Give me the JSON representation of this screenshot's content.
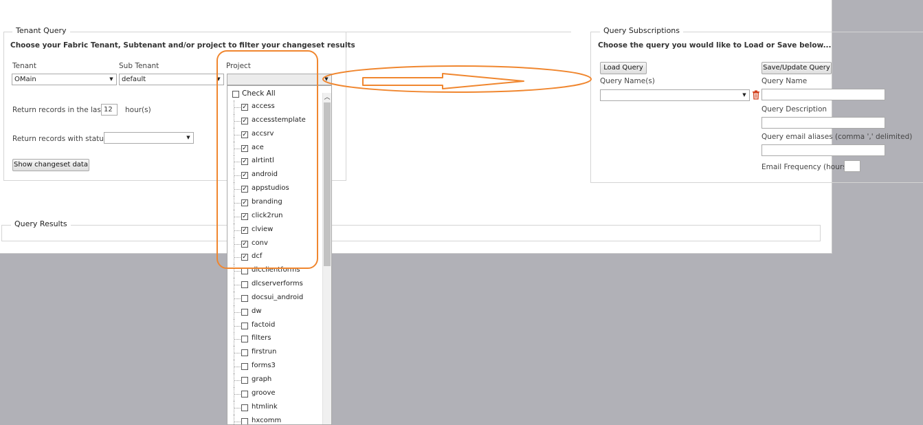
{
  "tenant_query": {
    "legend": "Tenant Query",
    "description": "Choose your Fabric Tenant, Subtenant and/or project to filter your changeset results",
    "tenant_label": "Tenant",
    "tenant_value": "OMain",
    "subtenant_label": "Sub Tenant",
    "subtenant_value": "default",
    "project_label": "Project",
    "project_value": "",
    "return_last_label": "Return records in the last :",
    "return_last_value": "12",
    "hours_label": "hour(s)",
    "status_label": "Return records with status :",
    "status_value": "",
    "show_button": "Show changeset data"
  },
  "project_dropdown": {
    "check_all_label": "Check All",
    "check_all_checked": false,
    "items": [
      {
        "label": "access",
        "checked": true
      },
      {
        "label": "accesstemplate",
        "checked": true
      },
      {
        "label": "accsrv",
        "checked": true
      },
      {
        "label": "ace",
        "checked": true
      },
      {
        "label": "alrtintl",
        "checked": true
      },
      {
        "label": "android",
        "checked": true
      },
      {
        "label": "appstudios",
        "checked": true
      },
      {
        "label": "branding",
        "checked": true
      },
      {
        "label": "click2run",
        "checked": true
      },
      {
        "label": "clview",
        "checked": true
      },
      {
        "label": "conv",
        "checked": true
      },
      {
        "label": "dcf",
        "checked": true
      },
      {
        "label": "dlcclientforms",
        "checked": false
      },
      {
        "label": "dlcserverforms",
        "checked": false
      },
      {
        "label": "docsui_android",
        "checked": false
      },
      {
        "label": "dw",
        "checked": false
      },
      {
        "label": "factoid",
        "checked": false
      },
      {
        "label": "filters",
        "checked": false
      },
      {
        "label": "firstrun",
        "checked": false
      },
      {
        "label": "forms3",
        "checked": false
      },
      {
        "label": "graph",
        "checked": false
      },
      {
        "label": "groove",
        "checked": false
      },
      {
        "label": "htmlink",
        "checked": false
      },
      {
        "label": "hxcomm",
        "checked": false
      }
    ]
  },
  "query_subscriptions": {
    "legend": "Query Subscriptions",
    "description": "Choose the query you would like to Load or Save below...",
    "load_button": "Load Query",
    "save_button": "Save/Update Query",
    "query_names_label": "Query Name(s)",
    "query_names_value": "",
    "query_name_label": "Query Name",
    "query_name_value": "",
    "query_description_label": "Query Description",
    "query_description_value": "",
    "email_aliases_label": "Query email aliases (comma ',' delimited)",
    "email_aliases_value": "",
    "email_frequency_label": "Email Frequency (hours)",
    "email_frequency_value": ""
  },
  "query_results": {
    "legend": "Query Results"
  },
  "colors": {
    "annotation": "#f0862e",
    "delete_icon": "#d2401c",
    "background": "#b1b1b7"
  }
}
